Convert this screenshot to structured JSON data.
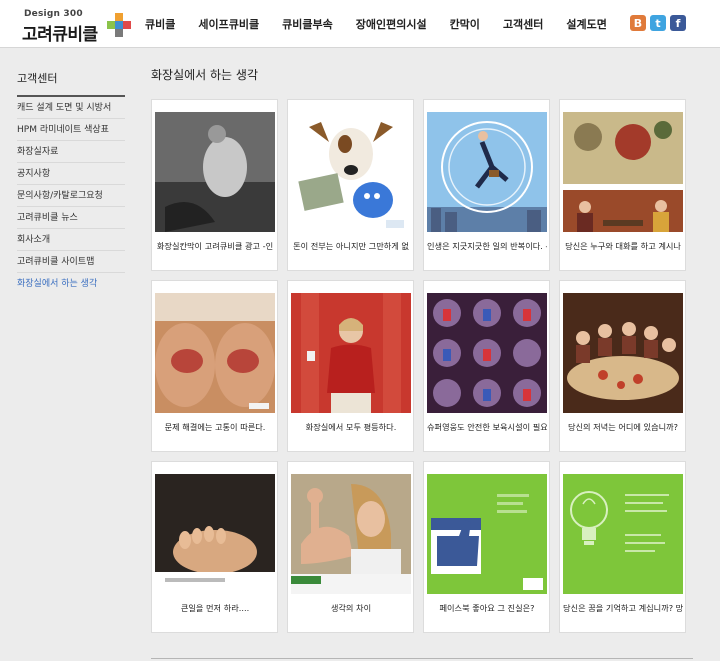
{
  "header": {
    "logo_small": "Design 300",
    "logo_main": "고려큐비클",
    "nav": [
      "큐비클",
      "세이프큐비클",
      "큐비클부속",
      "장애인편의시설",
      "칸막이",
      "고객센터",
      "설계도면"
    ],
    "social_icons": [
      "blog-icon",
      "twitter-icon",
      "facebook-icon"
    ],
    "social_glyphs": [
      "B",
      "t",
      "f"
    ]
  },
  "sidebar": {
    "title": "고객센터",
    "items": [
      {
        "label": "캐드 설계 도면 및 시방서"
      },
      {
        "label": "HPM 라미네이트 색상표"
      },
      {
        "label": "화장실자료"
      },
      {
        "label": "공지사항"
      },
      {
        "label": "문의사항/카탈로그요청"
      },
      {
        "label": "고려큐비클 뉴스"
      },
      {
        "label": "회사소개"
      },
      {
        "label": "고려큐비클 사이트맵"
      },
      {
        "label": "화장실에서 하는 생각",
        "active": true
      }
    ]
  },
  "main": {
    "title": "화장실에서 하는 생각",
    "cards": [
      {
        "caption": "화장실칸막이 고려큐비클 광고 -인",
        "image": "bw-figure-photo"
      },
      {
        "caption": "돈이 전부는 아니지만 그만하게 없",
        "image": "dog-money-ad"
      },
      {
        "caption": "인생은 지긋지긋한 일의 반복이다. -",
        "image": "hamster-wheel-man"
      },
      {
        "caption": "당신은 누구와 대화를 하고 계시나",
        "image": "dinner-conversation"
      },
      {
        "caption": "문제 해결에는 고통이 따른다.",
        "image": "knees-photo"
      },
      {
        "caption": "화장실에서 모두 평등하다.",
        "image": "woman-red-jacket"
      },
      {
        "caption": "슈퍼영웅도 안전한 보육시설이 필요",
        "image": "superhero-grid"
      },
      {
        "caption": "당신의 저녁는 어디에 있습니까?",
        "image": "family-dinner"
      },
      {
        "caption": "큰일을 먼저 하라....",
        "image": "feet-photo"
      },
      {
        "caption": "생각의 차이",
        "image": "girl-arm"
      },
      {
        "caption": "페이스북 좋아요 그 진실은?",
        "image": "facebook-like"
      },
      {
        "caption": "당신은 꿈을 기억하고 계십니까? 망",
        "image": "green-lightbulb"
      }
    ]
  },
  "colors": {
    "accent": "#3b6fc0",
    "background": "#ececec"
  }
}
